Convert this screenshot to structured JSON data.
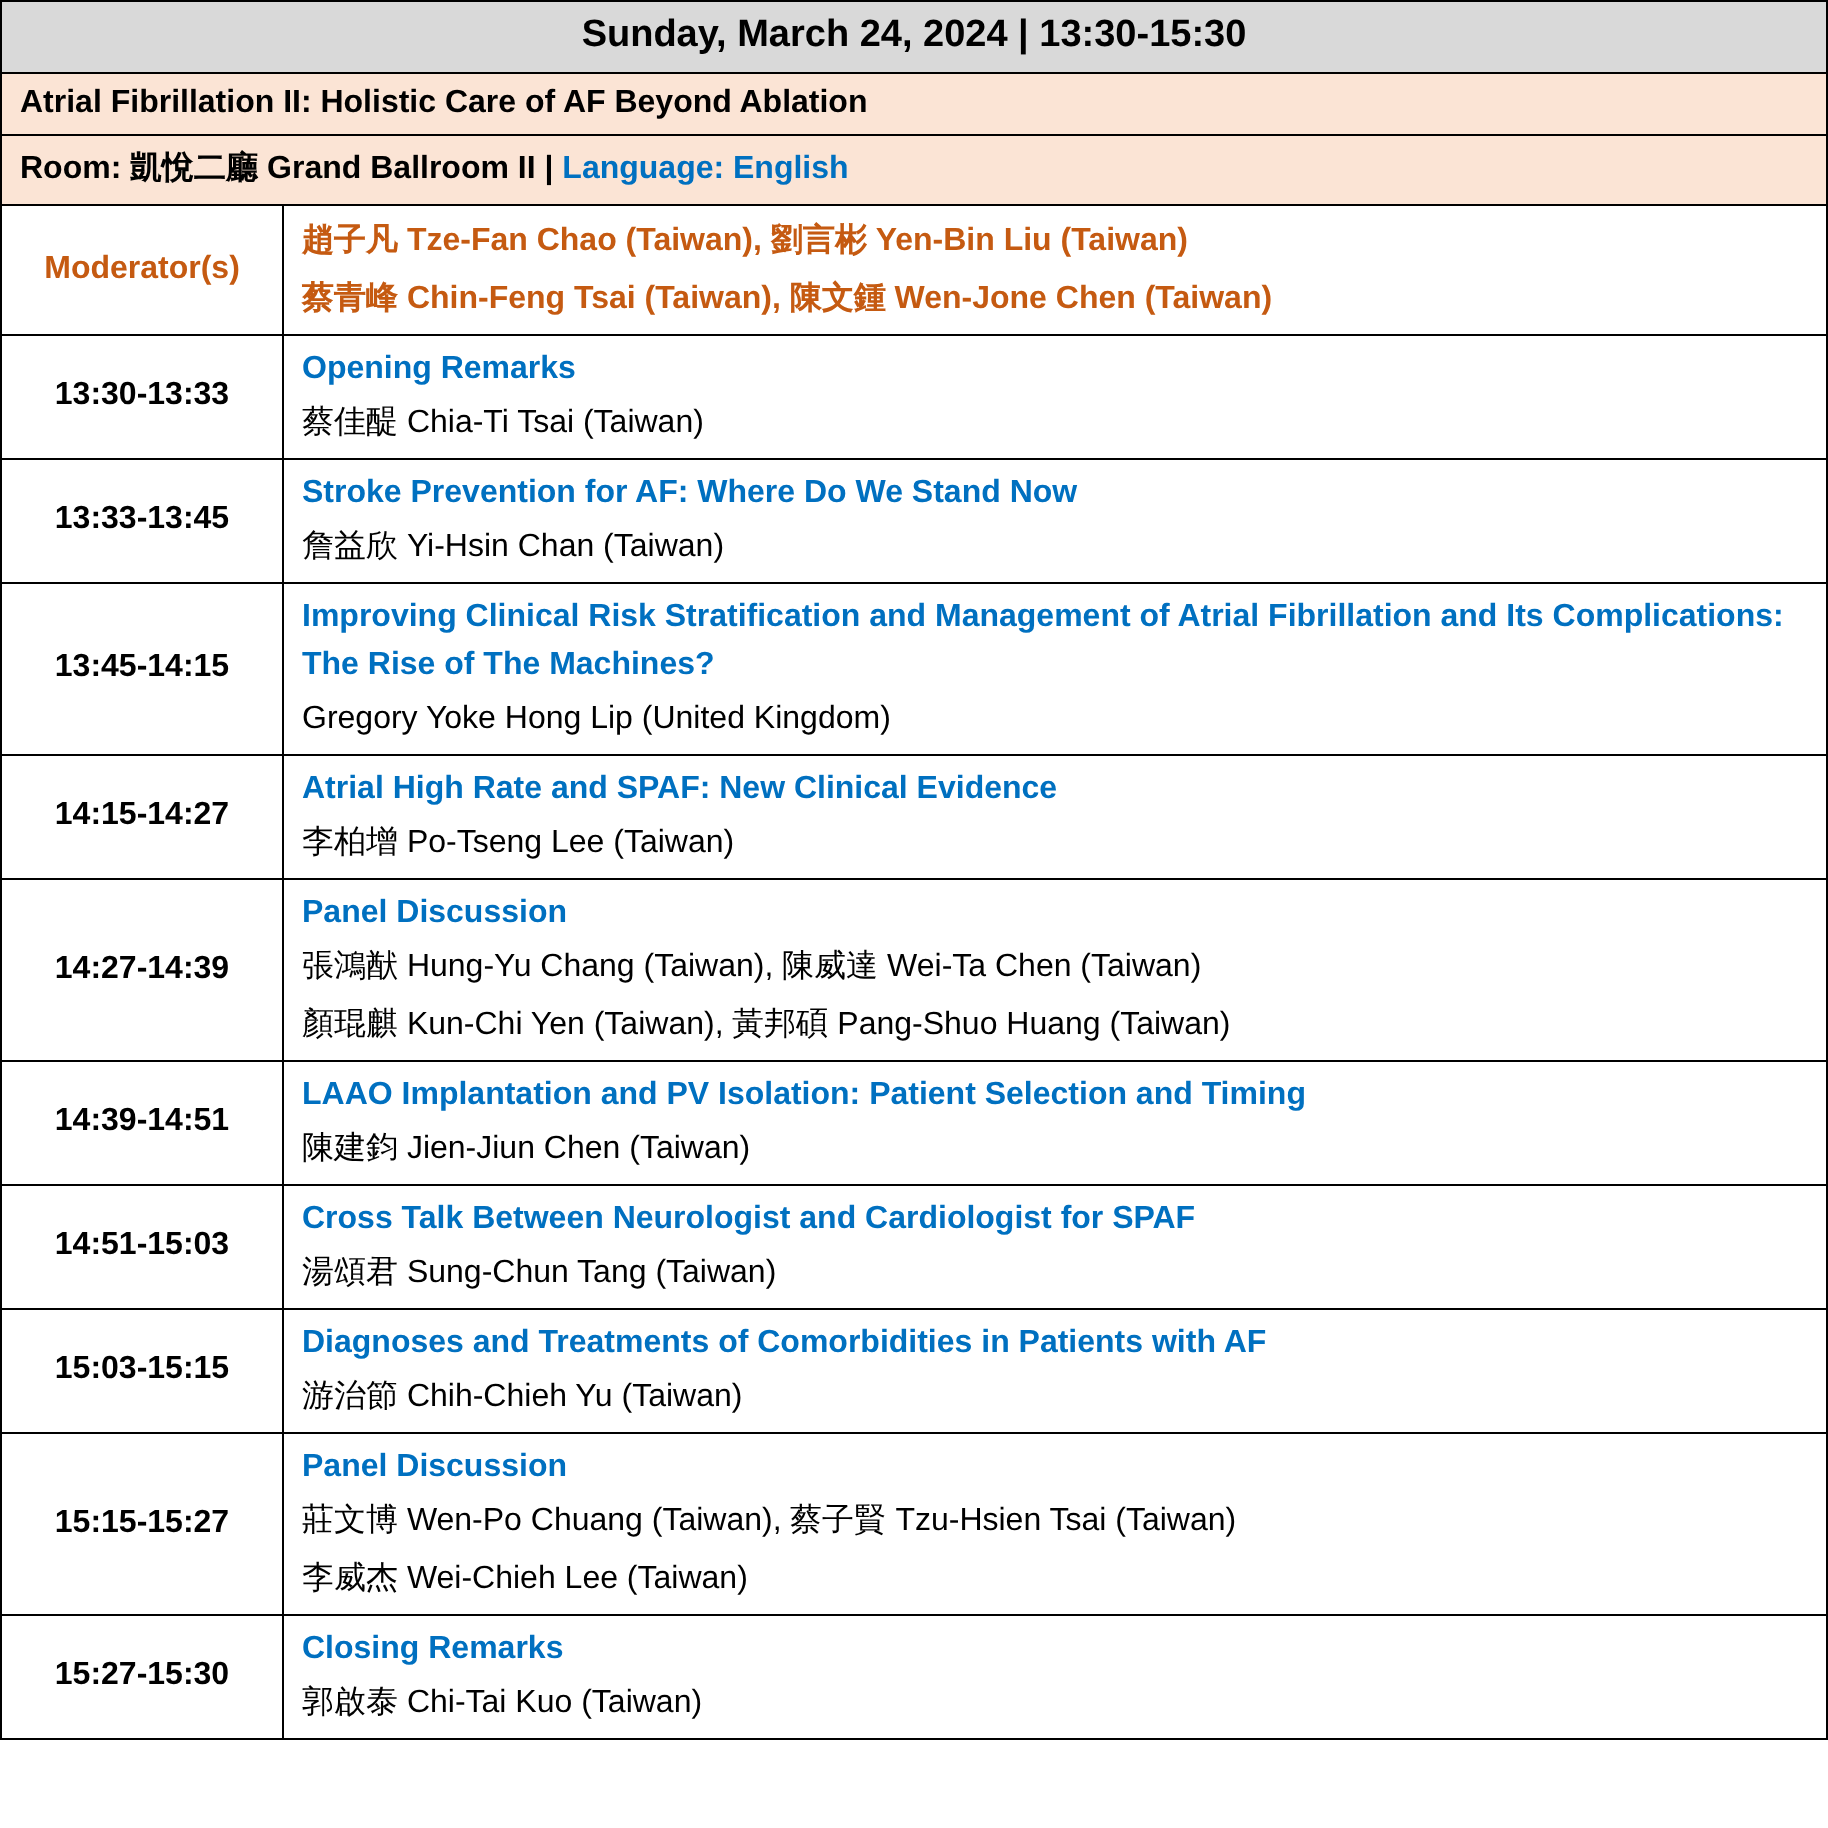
{
  "header": {
    "date_time": "Sunday, March 24, 2024 | 13:30-15:30"
  },
  "session_title": "Atrial Fibrillation II: Holistic Care of AF Beyond Ablation",
  "room": {
    "label": "Room: 凱悅二廳 Grand Ballroom II |",
    "language": "Language: English"
  },
  "moderators": {
    "label": "Moderator(s)",
    "lines": [
      "趙子凡 Tze-Fan Chao (Taiwan), 劉言彬 Yen-Bin Liu (Taiwan)",
      "蔡青峰 Chin-Feng Tsai (Taiwan), 陳文鍾 Wen-Jone Chen (Taiwan)"
    ]
  },
  "program": [
    {
      "time": "13:30-13:33",
      "topic": "Opening Remarks",
      "speakers": [
        "蔡佳醍 Chia-Ti Tsai (Taiwan)"
      ]
    },
    {
      "time": "13:33-13:45",
      "topic": "Stroke Prevention for AF: Where Do We Stand Now",
      "speakers": [
        "詹益欣 Yi-Hsin Chan (Taiwan)"
      ]
    },
    {
      "time": "13:45-14:15",
      "topic": "Improving Clinical Risk Stratification and Management of Atrial Fibrillation and Its Complications: The Rise of The Machines?",
      "speakers": [
        "Gregory Yoke Hong Lip (United Kingdom)"
      ]
    },
    {
      "time": "14:15-14:27",
      "topic": "Atrial High Rate and SPAF: New Clinical Evidence",
      "speakers": [
        "李柏增 Po-Tseng Lee (Taiwan)"
      ]
    },
    {
      "time": "14:27-14:39",
      "topic": "Panel Discussion",
      "speakers": [
        "張鴻猷 Hung-Yu Chang (Taiwan), 陳威達 Wei-Ta Chen (Taiwan)",
        "顏琨麒 Kun-Chi Yen (Taiwan), 黃邦碩 Pang-Shuo Huang (Taiwan)"
      ]
    },
    {
      "time": "14:39-14:51",
      "topic": "LAAO Implantation and PV Isolation: Patient Selection and Timing",
      "speakers": [
        "陳建鈞 Jien-Jiun Chen (Taiwan)"
      ]
    },
    {
      "time": "14:51-15:03",
      "topic": "Cross Talk Between Neurologist and Cardiologist for SPAF",
      "speakers": [
        "湯頌君 Sung-Chun Tang (Taiwan)"
      ]
    },
    {
      "time": "15:03-15:15",
      "topic": "Diagnoses and Treatments of Comorbidities in Patients with AF",
      "speakers": [
        "游治節 Chih-Chieh Yu (Taiwan)"
      ]
    },
    {
      "time": "15:15-15:27",
      "topic": "Panel Discussion",
      "speakers": [
        "莊文博 Wen-Po Chuang (Taiwan), 蔡子賢 Tzu-Hsien Tsai (Taiwan)",
        "李威杰 Wei-Chieh Lee (Taiwan)"
      ]
    },
    {
      "time": "15:27-15:30",
      "topic": "Closing Remarks",
      "speakers": [
        "郭啟泰 Chi-Tai Kuo (Taiwan)"
      ]
    }
  ]
}
